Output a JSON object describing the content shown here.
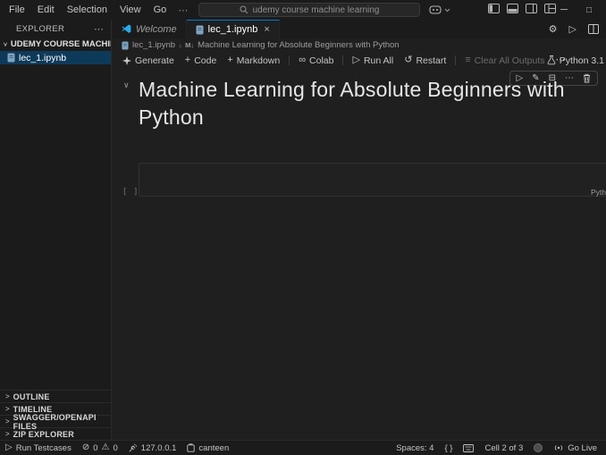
{
  "colors": {
    "accent_blue": "#0078d4",
    "titlebar_bg": "#1b1b1b",
    "editor_bg": "#1f1f1f",
    "selection_bg": "#0e3a5a",
    "vscode_logo_blue": "#29a9f0"
  },
  "titlebar": {
    "menus": [
      "File",
      "Edit",
      "Selection",
      "View",
      "Go"
    ],
    "overflow": "⋯",
    "search_value": "udemy course machine learning"
  },
  "glyphs": {
    "back": "←",
    "forward": "→",
    "minimize": "─",
    "maximize": "□",
    "close": "×",
    "chevron_down": "∨",
    "chevron_right": ">",
    "chevron_small": "∨",
    "more": "⋯",
    "plus": "+",
    "infinity": "∞",
    "play": "▷",
    "restart": "↺",
    "clear": "≡",
    "gear": "⚙",
    "pencil": "✎",
    "split": "⊟",
    "error": "⊘",
    "warning": "⚠",
    "markdown": "M↓",
    "brackets": "{ }"
  },
  "tabs": {
    "welcome": "Welcome",
    "notebook": "lec_1.ipynb"
  },
  "breadcrumb": {
    "file": "lec_1.ipynb",
    "separator": "›",
    "heading": "Machine Learning for Absolute Beginners with Python"
  },
  "toolbar": {
    "generate": "Generate",
    "code": "Code",
    "markdown": "Markdown",
    "colab": "Colab",
    "run_all": "Run All",
    "restart": "Restart",
    "clear_outputs": "Clear All Outputs",
    "kernel": "Python 3.1"
  },
  "explorer": {
    "title": "EXPLORER",
    "folder": "UDEMY COURSE MACHINE LEA...",
    "file": "lec_1.ipynb",
    "sections": [
      "OUTLINE",
      "TIMELINE",
      "SWAGGER/OPENAPI FILES",
      "ZIP EXPLORER"
    ]
  },
  "notebook": {
    "heading": "Machine Learning for Absolute Beginners with Python",
    "exec_count": "[ ]",
    "language": "Python"
  },
  "statusbar": {
    "run_testcases": "Run Testcases",
    "errors": "0",
    "warnings": "0",
    "host": "127.0.0.1",
    "profile": "canteen",
    "spaces": "Spaces: 4",
    "cell_position": "Cell 2 of 3",
    "go_live": "Go Live"
  }
}
